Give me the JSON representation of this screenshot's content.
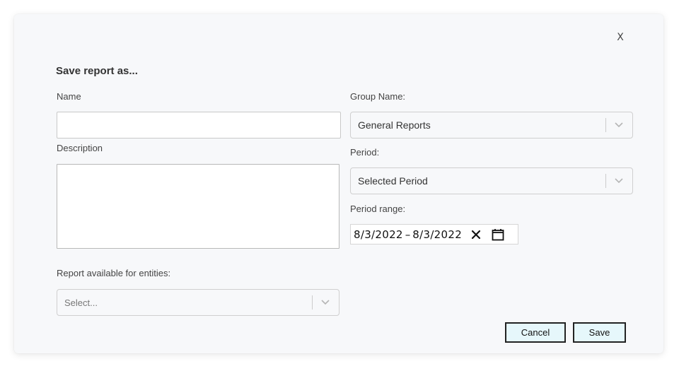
{
  "dialog": {
    "title": "Save report as...",
    "close_label": "X"
  },
  "form": {
    "name": {
      "label": "Name",
      "value": ""
    },
    "description": {
      "label": "Description",
      "value": ""
    },
    "entities": {
      "label": "Report available for entities:",
      "placeholder": "Select..."
    },
    "group": {
      "label": "Group Name:",
      "selected": "General Reports"
    },
    "period": {
      "label": "Period:",
      "selected": "Selected Period"
    },
    "period_range": {
      "label": "Period range:",
      "start": "8/3/2022",
      "separator": "–",
      "end": "8/3/2022"
    }
  },
  "buttons": {
    "cancel": "Cancel",
    "save": "Save"
  },
  "icons": {
    "close": "close-icon",
    "chevron": "chevron-down-icon",
    "clear": "clear-icon",
    "calendar": "calendar-icon"
  },
  "colors": {
    "dialog_bg": "#f7f8fa",
    "button_bg": "#e6f7fb",
    "button_border": "#222222"
  }
}
